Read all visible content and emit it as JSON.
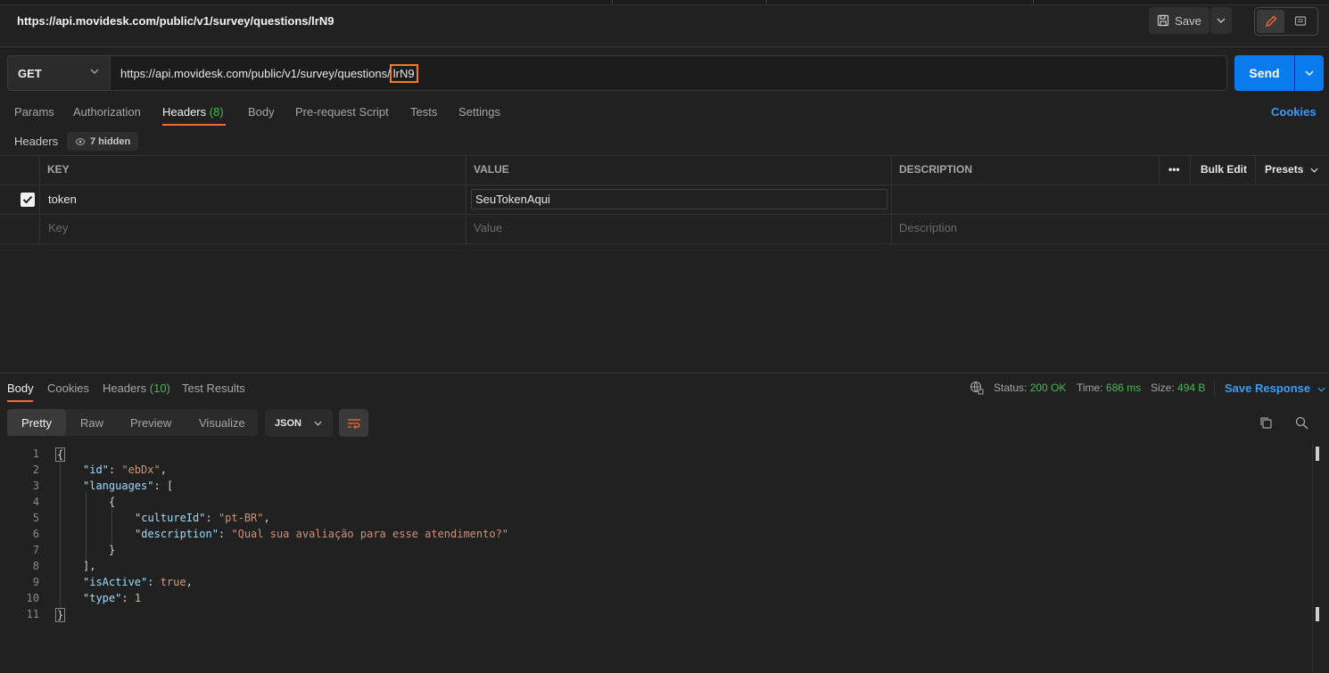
{
  "request": {
    "title": "https://api.movidesk.com/public/v1/survey/questions/lrN9",
    "method": "GET",
    "url_base": "https://api.movidesk.com/public/v1/survey/questions/",
    "url_highlight": "lrN9",
    "save_label": "Save",
    "send_label": "Send"
  },
  "tabs": [
    {
      "label": "Params"
    },
    {
      "label": "Authorization"
    },
    {
      "label": "Headers",
      "count": "(8)"
    },
    {
      "label": "Body"
    },
    {
      "label": "Pre-request Script"
    },
    {
      "label": "Tests"
    },
    {
      "label": "Settings"
    }
  ],
  "cookies_label": "Cookies",
  "headers": {
    "label": "Headers",
    "hidden": "7 hidden",
    "columns": {
      "key": "KEY",
      "value": "VALUE",
      "description": "DESCRIPTION"
    },
    "more": "•••",
    "bulk_edit": "Bulk Edit",
    "presets": "Presets",
    "rows": [
      {
        "checked": true,
        "key": "token",
        "value": "SeuTokenAqui",
        "description": ""
      }
    ],
    "placeholders": {
      "key": "Key",
      "value": "Value",
      "description": "Description"
    }
  },
  "response": {
    "tabs": [
      {
        "label": "Body"
      },
      {
        "label": "Cookies"
      },
      {
        "label": "Headers",
        "count": "(10)"
      },
      {
        "label": "Test Results"
      }
    ],
    "status_label": "Status:",
    "status_value": "200 OK",
    "time_label": "Time:",
    "time_value": "686 ms",
    "size_label": "Size:",
    "size_value": "494 B",
    "save_response": "Save Response",
    "views": [
      "Pretty",
      "Raw",
      "Preview",
      "Visualize"
    ],
    "format": "JSON",
    "code": {
      "line_numbers": [
        "1",
        "2",
        "3",
        "4",
        "5",
        "6",
        "7",
        "8",
        "9",
        "10",
        "11"
      ],
      "open_brace": "{",
      "id_key": "\"id\"",
      "id_val": "\"ebDx\"",
      "languages_key": "\"languages\"",
      "open_bracket": "[",
      "inner_open": "{",
      "culture_key": "\"cultureId\"",
      "culture_val": "\"pt-BR\"",
      "desc_key": "\"description\"",
      "desc_val": "\"Qual sua avaliação para esse atendimento?\"",
      "inner_close": "}",
      "close_bracket": "],",
      "active_key": "\"isActive\"",
      "active_val": "true",
      "type_key": "\"type\"",
      "type_val": "1",
      "close_brace": "}"
    }
  }
}
